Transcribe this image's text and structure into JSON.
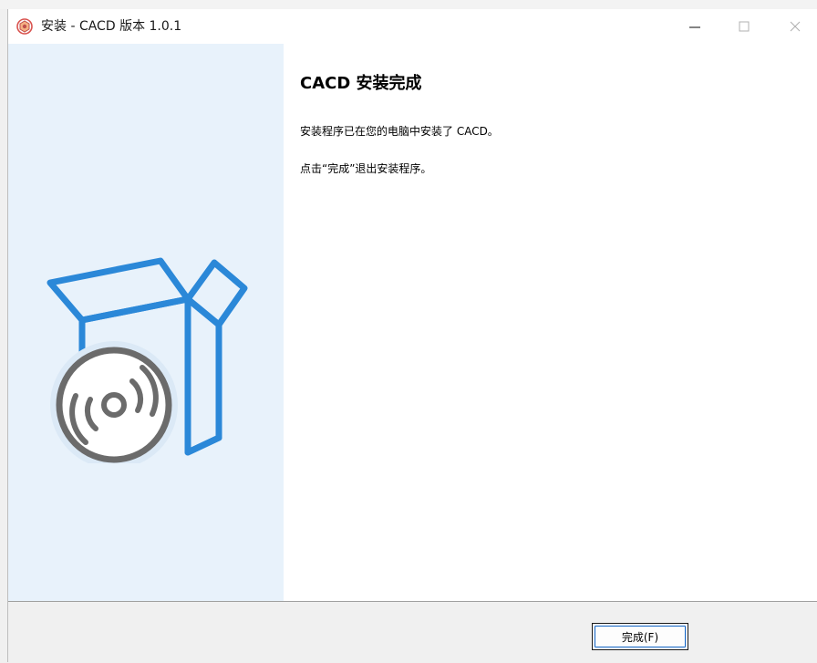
{
  "window": {
    "title": "安装 - CACD 版本 1.0.1",
    "controls": {
      "minimize": "—",
      "maximize": "☐",
      "close": "✕"
    }
  },
  "sidebar": {
    "illustration": "software-box-cd-icon",
    "background": "#e8f2fb"
  },
  "content": {
    "heading": "CACD 安装完成",
    "paragraph1": "安装程序已在您的电脑中安装了 CACD。",
    "paragraph2": "点击“完成”退出安装程序。"
  },
  "footer": {
    "finish_button": "完成(F)"
  },
  "colors": {
    "accent": "#2b88d8",
    "disc": "#6b6b6b",
    "focus": "#0f62c4"
  }
}
